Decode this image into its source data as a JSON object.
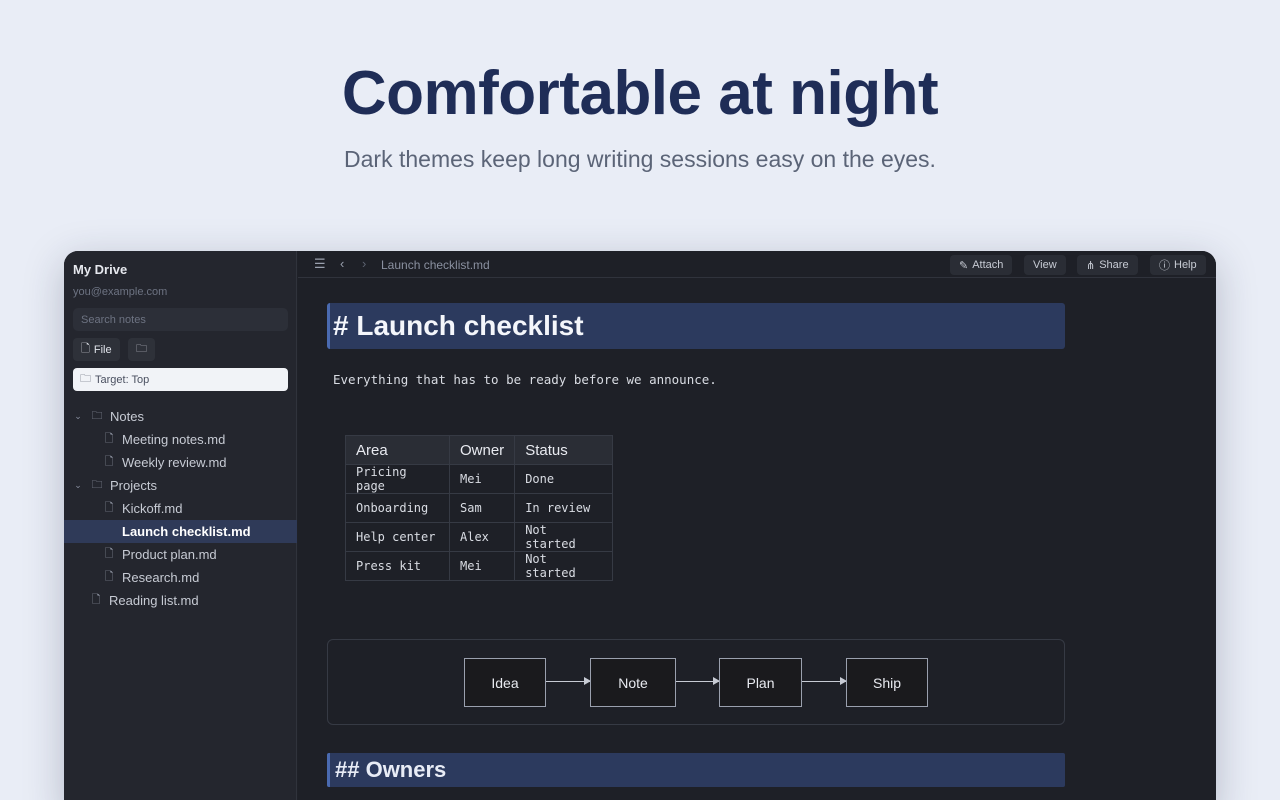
{
  "hero": {
    "title": "Comfortable at night",
    "subtitle": "Dark themes keep long writing sessions easy on the eyes."
  },
  "sidebar": {
    "title": "My Drive",
    "email": "you@example.com",
    "search_placeholder": "Search notes",
    "file_button": "File",
    "target_label": "Target: Top",
    "tree": {
      "notes": "Notes",
      "meeting": "Meeting notes.md",
      "weekly": "Weekly review.md",
      "projects": "Projects",
      "kickoff": "Kickoff.md",
      "launch": "Launch checklist.md",
      "product": "Product plan.md",
      "research": "Research.md",
      "reading": "Reading list.md"
    }
  },
  "toolbar": {
    "breadcrumb": "Launch checklist.md",
    "attach": "Attach",
    "view": "View",
    "share": "Share",
    "help": "Help"
  },
  "doc": {
    "h1": "# Launch checklist",
    "paragraph": "Everything that has to be ready before we announce.",
    "table": {
      "headers": [
        "Area",
        "Owner",
        "Status"
      ],
      "rows": [
        [
          "Pricing page",
          "Mei",
          "Done"
        ],
        [
          "Onboarding",
          "Sam",
          "In review"
        ],
        [
          "Help center",
          "Alex",
          "Not started"
        ],
        [
          "Press kit",
          "Mei",
          "Not started"
        ]
      ]
    },
    "flow": [
      "Idea",
      "Note",
      "Plan",
      "Ship"
    ],
    "h2": "## Owners"
  },
  "colors": {
    "accent": "#2c3a5e",
    "hero_title": "#1f2d57",
    "window_bg": "#1f2128",
    "sidebar_bg": "#24262e"
  }
}
